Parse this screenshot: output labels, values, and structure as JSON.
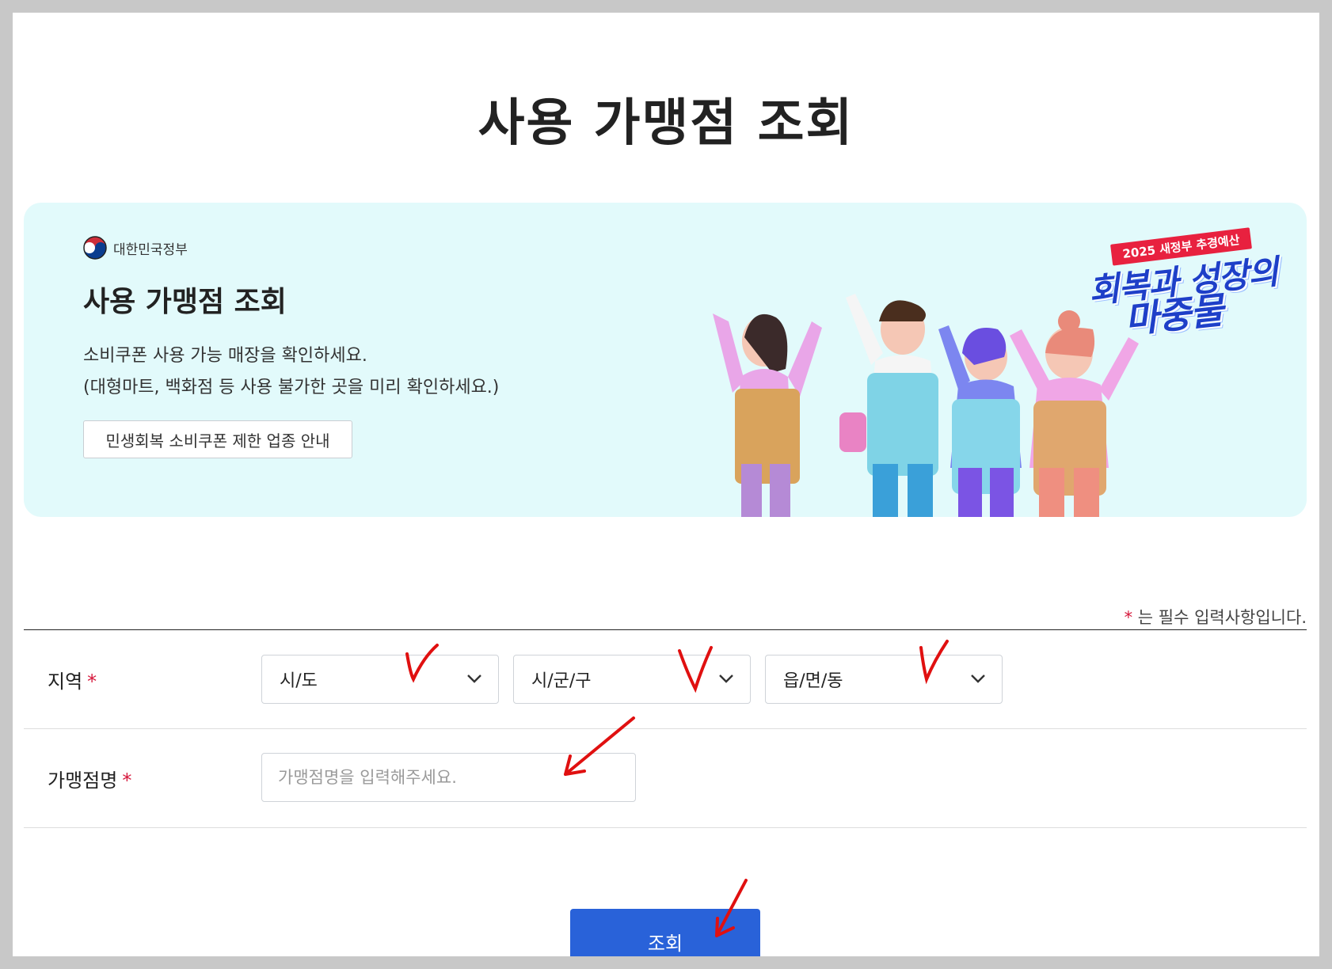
{
  "page": {
    "title": "사용 가맹점 조회"
  },
  "banner": {
    "gov_name": "대한민국정부",
    "title": "사용 가맹점 조회",
    "desc_line1": "소비쿠폰 사용 가능 매장을 확인하세요.",
    "desc_line2": "(대형마트, 백화점 등 사용 불가한 곳을 미리 확인하세요.)",
    "guide_button": "민생회복 소비쿠폰 제한 업종 안내",
    "slogan_tag": "2025 새정부 추경예산",
    "slogan_line1": "회복과 성장의",
    "slogan_line2": "마중물"
  },
  "form": {
    "required_star": "*",
    "required_note": "는 필수 입력사항입니다.",
    "region_label": "지역",
    "region_selects": [
      "시/도",
      "시/군/구",
      "읍/면/동"
    ],
    "store_label": "가맹점명",
    "store_placeholder": "가맹점명을 입력해주세요.",
    "submit_label": "조회"
  },
  "colors": {
    "banner_bg": "#e2fafb",
    "required_red": "#d6173b",
    "submit_blue": "#2962d9",
    "annotation_red": "#e01010"
  },
  "icons": [
    "taegeuk-emblem-icon",
    "chevron-down-icon"
  ]
}
